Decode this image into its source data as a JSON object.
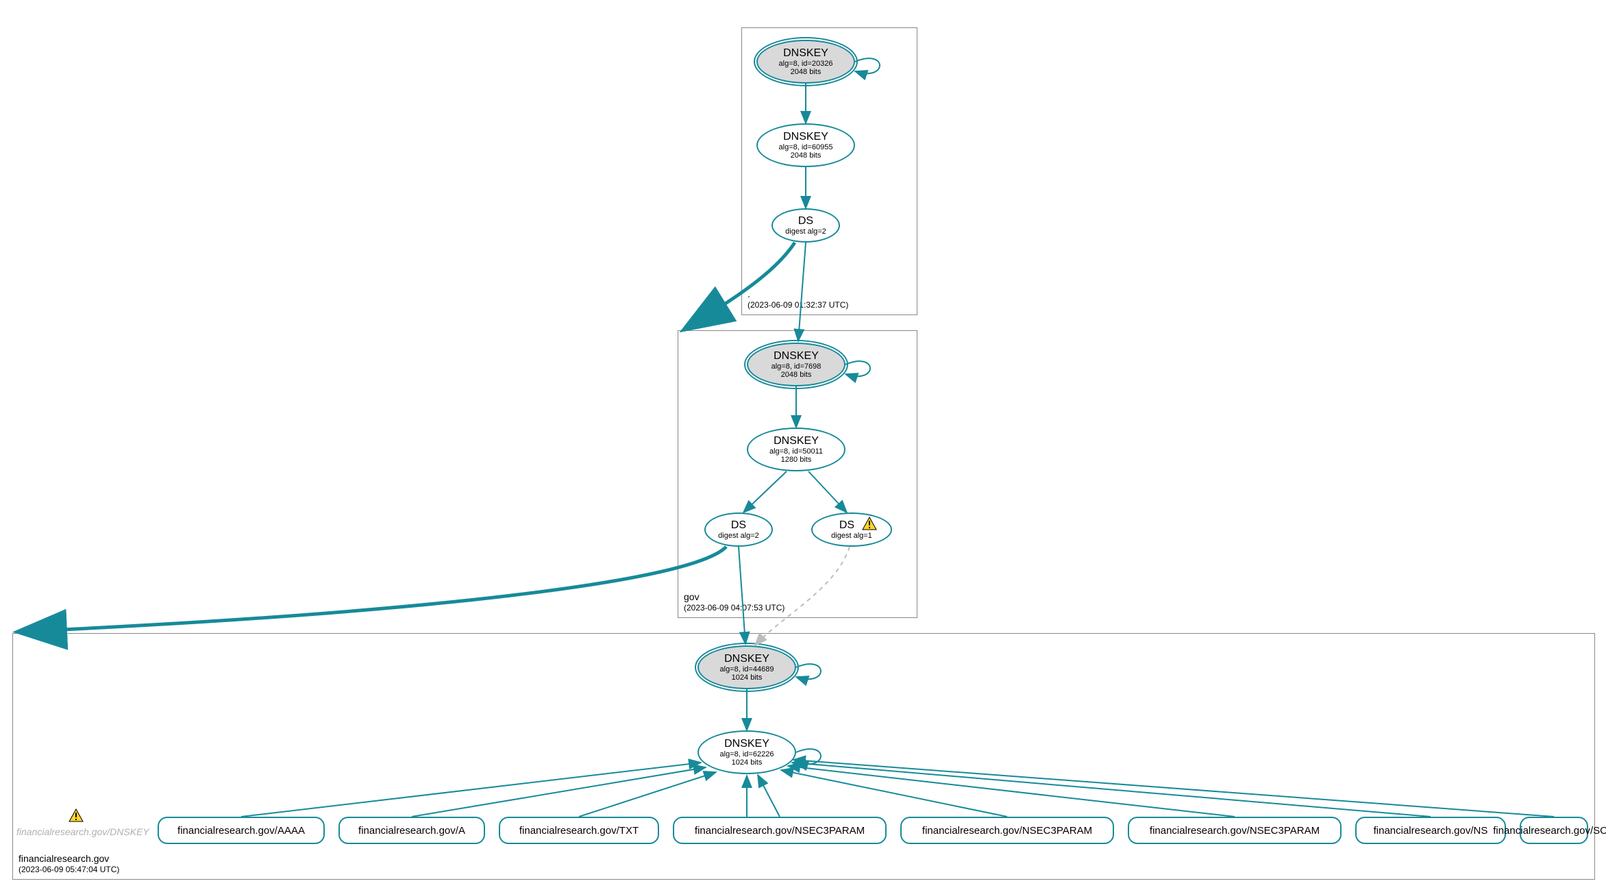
{
  "colors": {
    "accent": "#178a99",
    "zone_border": "#888888",
    "ghost_text": "#b0b0b0",
    "warn_fill": "#ffd42a",
    "warn_stroke": "#000000"
  },
  "zones": {
    "root": {
      "name": ".",
      "timestamp": "(2023-06-09 01:32:37 UTC)"
    },
    "gov": {
      "name": "gov",
      "timestamp": "(2023-06-09 04:07:53 UTC)"
    },
    "fr": {
      "name": "financialresearch.gov",
      "timestamp": "(2023-06-09 05:47:04 UTC)"
    }
  },
  "nodes": {
    "root_ksk": {
      "title": "DNSKEY",
      "sub1": "alg=8, id=20326",
      "sub2": "2048 bits"
    },
    "root_zsk": {
      "title": "DNSKEY",
      "sub1": "alg=8, id=60955",
      "sub2": "2048 bits"
    },
    "root_ds": {
      "title": "DS",
      "sub1": "digest alg=2",
      "sub2": ""
    },
    "gov_ksk": {
      "title": "DNSKEY",
      "sub1": "alg=8, id=7698",
      "sub2": "2048 bits"
    },
    "gov_zsk": {
      "title": "DNSKEY",
      "sub1": "alg=8, id=50011",
      "sub2": "1280 bits"
    },
    "gov_ds1": {
      "title": "DS",
      "sub1": "digest alg=2",
      "sub2": ""
    },
    "gov_ds2": {
      "title": "DS",
      "sub1": "digest alg=1",
      "sub2": ""
    },
    "fr_ksk": {
      "title": "DNSKEY",
      "sub1": "alg=8, id=44689",
      "sub2": "1024 bits"
    },
    "fr_zsk": {
      "title": "DNSKEY",
      "sub1": "alg=8, id=62226",
      "sub2": "1024 bits"
    }
  },
  "records": {
    "ghost_dnskey": "financialresearch.gov/DNSKEY",
    "aaaa": "financialresearch.gov/AAAA",
    "a": "financialresearch.gov/A",
    "txt": "financialresearch.gov/TXT",
    "n3p1": "financialresearch.gov/NSEC3PARAM",
    "n3p2": "financialresearch.gov/NSEC3PARAM",
    "n3p3": "financialresearch.gov/NSEC3PARAM",
    "ns": "financialresearch.gov/NS",
    "soa": "financialresearch.gov/SOA"
  }
}
